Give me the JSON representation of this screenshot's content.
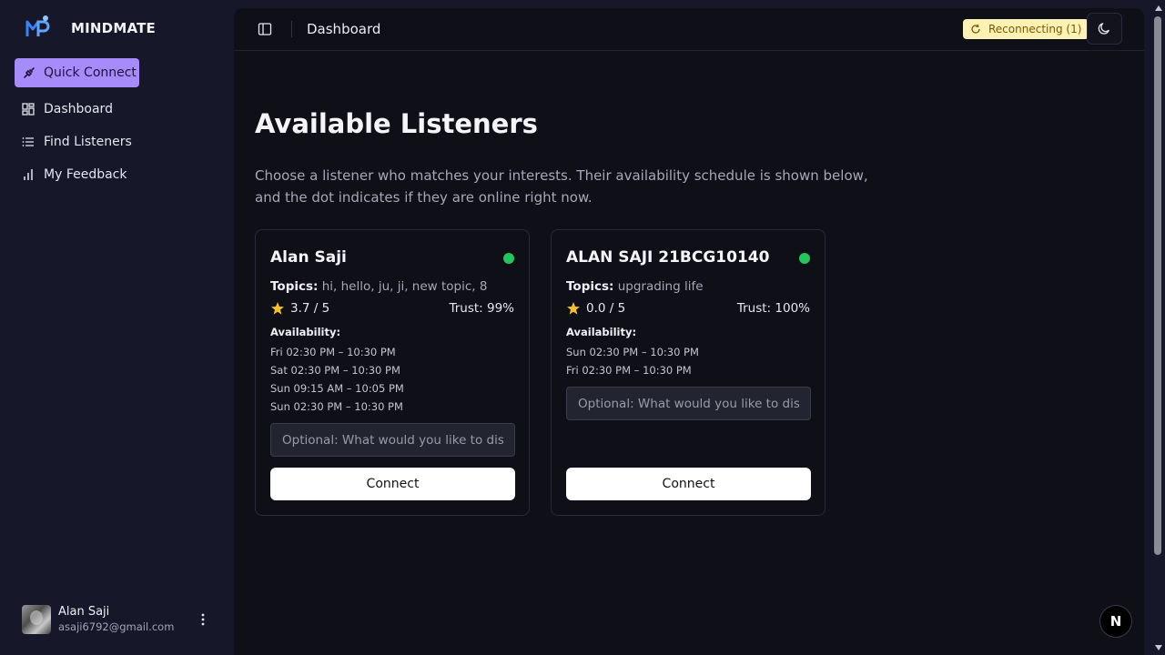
{
  "brand": {
    "name": "MINDMATE"
  },
  "sidebar": {
    "quick_connect": "Quick Connect",
    "items": [
      {
        "label": "Dashboard",
        "icon": "dashboard-icon"
      },
      {
        "label": "Find Listeners",
        "icon": "list-icon"
      },
      {
        "label": "My Feedback",
        "icon": "bar-chart-icon"
      }
    ],
    "user": {
      "name": "Alan Saji",
      "email": "asaji6792@gmail.com"
    }
  },
  "topbar": {
    "breadcrumb": "Dashboard",
    "status": "Reconnecting (1)"
  },
  "main": {
    "title": "Available Listeners",
    "subtitle": "Choose a listener who matches your interests. Their availability schedule is shown below, and the dot indicates if they are online right now."
  },
  "listeners": [
    {
      "name": "Alan Saji",
      "online": true,
      "topics_label": "Topics:",
      "topics": "hi, hello, ju, ji, new topic, 8",
      "rating": "3.7 / 5",
      "trust": "Trust: 99%",
      "availability_label": "Availability:",
      "slots": [
        "Fri 02:30 PM – 10:30 PM",
        "Sat 02:30 PM – 10:30 PM",
        "Sun 09:15 AM – 10:05 PM",
        "Sun 02:30 PM – 10:30 PM"
      ],
      "note_placeholder": "Optional: What would you like to discuss?",
      "connect_label": "Connect"
    },
    {
      "name": "ALAN SAJI 21BCG10140",
      "online": true,
      "topics_label": "Topics:",
      "topics": "upgrading life",
      "rating": "0.0 / 5",
      "trust": "Trust: 100%",
      "availability_label": "Availability:",
      "slots": [
        "Sun 02:30 PM – 10:30 PM",
        "Fri 02:30 PM – 10:30 PM"
      ],
      "note_placeholder": "Optional: What would you like to discuss?",
      "connect_label": "Connect"
    }
  ],
  "colors": {
    "accent": "#a78bfa",
    "online": "#22c55e",
    "status_bg": "#fdf1b5",
    "star": "#f5c02b"
  },
  "badge": {
    "label": "N"
  }
}
